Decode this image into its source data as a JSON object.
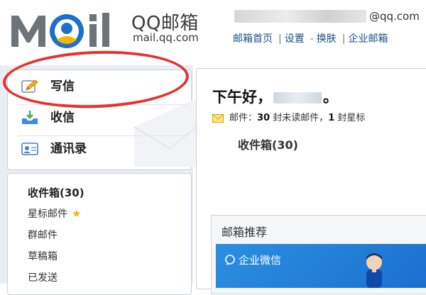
{
  "header": {
    "logo_brand": "QQ邮箱",
    "logo_domain": "mail.qq.com",
    "account_domain": "@qq.com",
    "links": [
      "邮箱首页",
      "设置",
      "换肤",
      "企业邮箱"
    ]
  },
  "nav": {
    "write": "写信",
    "inbox": "收信",
    "contacts": "通讯录"
  },
  "folders": {
    "inbox": "收件箱(30)",
    "starred": "星标邮件",
    "group": "群邮件",
    "drafts": "草稿箱",
    "sent": "已发送"
  },
  "main": {
    "greeting": "下午好，",
    "greeting_end": "。",
    "mail_prefix": "邮件：",
    "unread_count": "30",
    "unread_text": " 封未读邮件，",
    "star_count": "1",
    "star_text": " 封星标",
    "inbox_link": "收件箱(30)"
  },
  "recommend": {
    "title": "邮箱推荐",
    "banner_text": "企业微信"
  },
  "colors": {
    "highlight": "#e5322d",
    "link": "#1a4d8c",
    "banner": "#2b8fe0"
  }
}
